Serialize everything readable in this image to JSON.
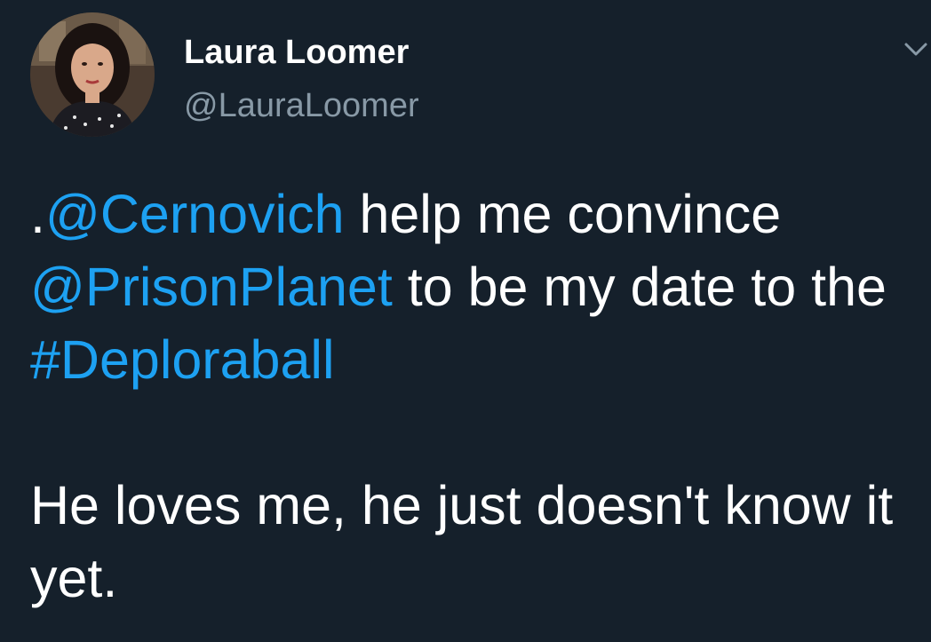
{
  "author": {
    "display_name": "Laura Loomer",
    "handle": "@LauraLoomer",
    "avatar_icon": "user-avatar-photo"
  },
  "menu": {
    "icon": "chevron-down-icon"
  },
  "tweet": {
    "line1_prefix": ".",
    "mention_1": "@Cernovich",
    "text_1": " help me convince ",
    "mention_2": "@PrisonPlanet",
    "text_2": " to be my date to the ",
    "hashtag": "#Deploraball",
    "paragraph_2": "He loves me, he just doesn't know it yet."
  },
  "colors": {
    "background": "#15202b",
    "link": "#1da1f2",
    "secondary_text": "#8899a6",
    "primary_text": "#ffffff"
  }
}
